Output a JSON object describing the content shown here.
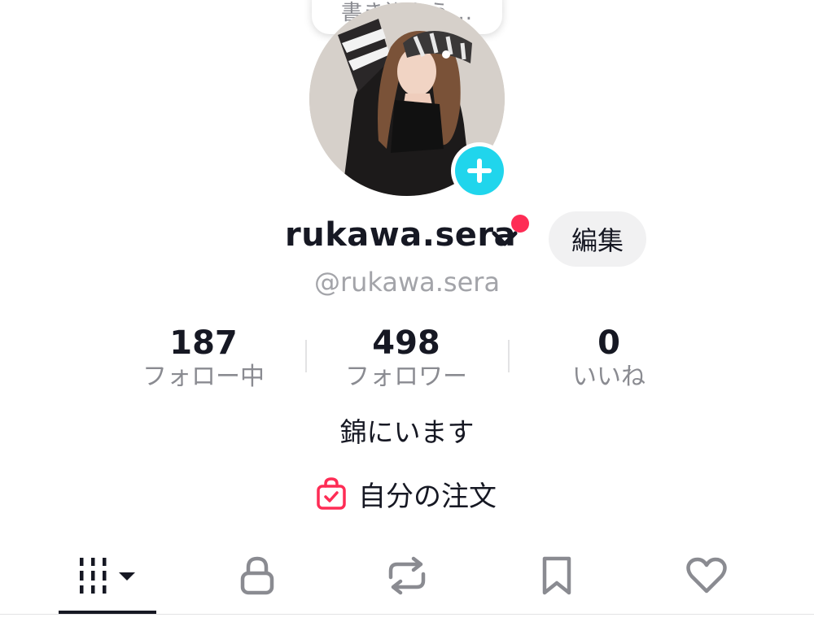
{
  "note": {
    "text": "書き込もう..."
  },
  "profile": {
    "username": "rukawa.sera",
    "handle": "@rukawa.sera",
    "edit_label": "編集",
    "bio": "錦にいます"
  },
  "stats": [
    {
      "value": "187",
      "label": "フォロー中"
    },
    {
      "value": "498",
      "label": "フォロワー"
    },
    {
      "value": "0",
      "label": "いいね"
    }
  ],
  "orders": {
    "label": "自分の注文",
    "icon": "shopping-bag-check-icon"
  },
  "tabs": [
    {
      "name": "videos",
      "icon": "grid-bars-icon",
      "active": true
    },
    {
      "name": "private",
      "icon": "lock-icon"
    },
    {
      "name": "reposts",
      "icon": "repost-icon"
    },
    {
      "name": "favorites",
      "icon": "bookmark-icon"
    },
    {
      "name": "liked",
      "icon": "heart-icon"
    }
  ],
  "colors": {
    "accent_cyan": "#20d5ec",
    "notification_red": "#fe2c55",
    "text_primary": "#161823",
    "text_secondary": "#8a8b91"
  }
}
